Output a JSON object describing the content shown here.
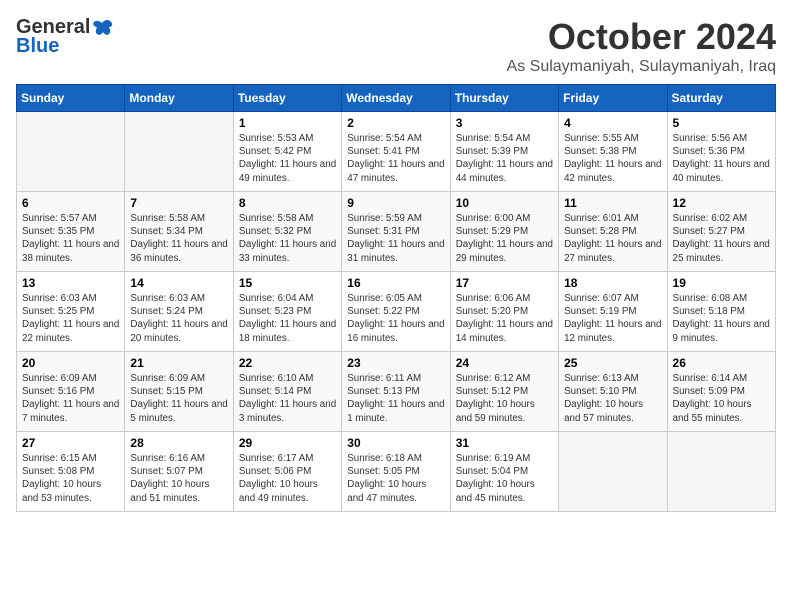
{
  "logo": {
    "general": "General",
    "blue": "Blue"
  },
  "title": "October 2024",
  "location": "As Sulaymaniyah, Sulaymaniyah, Iraq",
  "days_of_week": [
    "Sunday",
    "Monday",
    "Tuesday",
    "Wednesday",
    "Thursday",
    "Friday",
    "Saturday"
  ],
  "weeks": [
    [
      {
        "day": "",
        "info": ""
      },
      {
        "day": "",
        "info": ""
      },
      {
        "day": "1",
        "info": "Sunrise: 5:53 AM\nSunset: 5:42 PM\nDaylight: 11 hours and 49 minutes."
      },
      {
        "day": "2",
        "info": "Sunrise: 5:54 AM\nSunset: 5:41 PM\nDaylight: 11 hours and 47 minutes."
      },
      {
        "day": "3",
        "info": "Sunrise: 5:54 AM\nSunset: 5:39 PM\nDaylight: 11 hours and 44 minutes."
      },
      {
        "day": "4",
        "info": "Sunrise: 5:55 AM\nSunset: 5:38 PM\nDaylight: 11 hours and 42 minutes."
      },
      {
        "day": "5",
        "info": "Sunrise: 5:56 AM\nSunset: 5:36 PM\nDaylight: 11 hours and 40 minutes."
      }
    ],
    [
      {
        "day": "6",
        "info": "Sunrise: 5:57 AM\nSunset: 5:35 PM\nDaylight: 11 hours and 38 minutes."
      },
      {
        "day": "7",
        "info": "Sunrise: 5:58 AM\nSunset: 5:34 PM\nDaylight: 11 hours and 36 minutes."
      },
      {
        "day": "8",
        "info": "Sunrise: 5:58 AM\nSunset: 5:32 PM\nDaylight: 11 hours and 33 minutes."
      },
      {
        "day": "9",
        "info": "Sunrise: 5:59 AM\nSunset: 5:31 PM\nDaylight: 11 hours and 31 minutes."
      },
      {
        "day": "10",
        "info": "Sunrise: 6:00 AM\nSunset: 5:29 PM\nDaylight: 11 hours and 29 minutes."
      },
      {
        "day": "11",
        "info": "Sunrise: 6:01 AM\nSunset: 5:28 PM\nDaylight: 11 hours and 27 minutes."
      },
      {
        "day": "12",
        "info": "Sunrise: 6:02 AM\nSunset: 5:27 PM\nDaylight: 11 hours and 25 minutes."
      }
    ],
    [
      {
        "day": "13",
        "info": "Sunrise: 6:03 AM\nSunset: 5:25 PM\nDaylight: 11 hours and 22 minutes."
      },
      {
        "day": "14",
        "info": "Sunrise: 6:03 AM\nSunset: 5:24 PM\nDaylight: 11 hours and 20 minutes."
      },
      {
        "day": "15",
        "info": "Sunrise: 6:04 AM\nSunset: 5:23 PM\nDaylight: 11 hours and 18 minutes."
      },
      {
        "day": "16",
        "info": "Sunrise: 6:05 AM\nSunset: 5:22 PM\nDaylight: 11 hours and 16 minutes."
      },
      {
        "day": "17",
        "info": "Sunrise: 6:06 AM\nSunset: 5:20 PM\nDaylight: 11 hours and 14 minutes."
      },
      {
        "day": "18",
        "info": "Sunrise: 6:07 AM\nSunset: 5:19 PM\nDaylight: 11 hours and 12 minutes."
      },
      {
        "day": "19",
        "info": "Sunrise: 6:08 AM\nSunset: 5:18 PM\nDaylight: 11 hours and 9 minutes."
      }
    ],
    [
      {
        "day": "20",
        "info": "Sunrise: 6:09 AM\nSunset: 5:16 PM\nDaylight: 11 hours and 7 minutes."
      },
      {
        "day": "21",
        "info": "Sunrise: 6:09 AM\nSunset: 5:15 PM\nDaylight: 11 hours and 5 minutes."
      },
      {
        "day": "22",
        "info": "Sunrise: 6:10 AM\nSunset: 5:14 PM\nDaylight: 11 hours and 3 minutes."
      },
      {
        "day": "23",
        "info": "Sunrise: 6:11 AM\nSunset: 5:13 PM\nDaylight: 11 hours and 1 minute."
      },
      {
        "day": "24",
        "info": "Sunrise: 6:12 AM\nSunset: 5:12 PM\nDaylight: 10 hours and 59 minutes."
      },
      {
        "day": "25",
        "info": "Sunrise: 6:13 AM\nSunset: 5:10 PM\nDaylight: 10 hours and 57 minutes."
      },
      {
        "day": "26",
        "info": "Sunrise: 6:14 AM\nSunset: 5:09 PM\nDaylight: 10 hours and 55 minutes."
      }
    ],
    [
      {
        "day": "27",
        "info": "Sunrise: 6:15 AM\nSunset: 5:08 PM\nDaylight: 10 hours and 53 minutes."
      },
      {
        "day": "28",
        "info": "Sunrise: 6:16 AM\nSunset: 5:07 PM\nDaylight: 10 hours and 51 minutes."
      },
      {
        "day": "29",
        "info": "Sunrise: 6:17 AM\nSunset: 5:06 PM\nDaylight: 10 hours and 49 minutes."
      },
      {
        "day": "30",
        "info": "Sunrise: 6:18 AM\nSunset: 5:05 PM\nDaylight: 10 hours and 47 minutes."
      },
      {
        "day": "31",
        "info": "Sunrise: 6:19 AM\nSunset: 5:04 PM\nDaylight: 10 hours and 45 minutes."
      },
      {
        "day": "",
        "info": ""
      },
      {
        "day": "",
        "info": ""
      }
    ]
  ]
}
